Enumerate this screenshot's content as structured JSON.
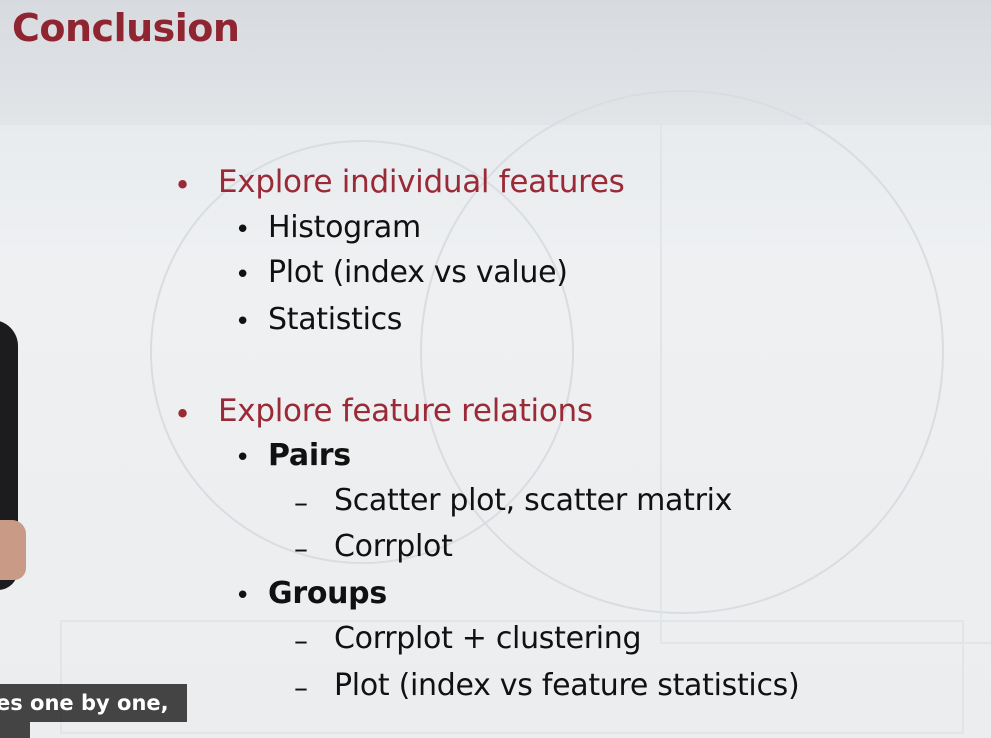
{
  "slide": {
    "title": "Conclusion",
    "sections": [
      {
        "label": "Explore individual features",
        "items": [
          "Histogram",
          "Plot (index vs value)",
          "Statistics"
        ]
      },
      {
        "label": "Explore feature relations",
        "groups": [
          {
            "label": "Pairs",
            "items": [
              "Scatter plot, scatter matrix",
              "Corrplot"
            ]
          },
          {
            "label": "Groups",
            "items": [
              "Corrplot + clustering",
              "Plot (index vs feature statistics)"
            ]
          }
        ]
      }
    ],
    "bullet_symbol": "•",
    "dash_symbol": "–"
  },
  "caption": {
    "text": "es one by one,"
  },
  "colors": {
    "title": "#8e2530",
    "section": "#9a2a36",
    "body_text": "#111111",
    "background": "#eceef0"
  }
}
